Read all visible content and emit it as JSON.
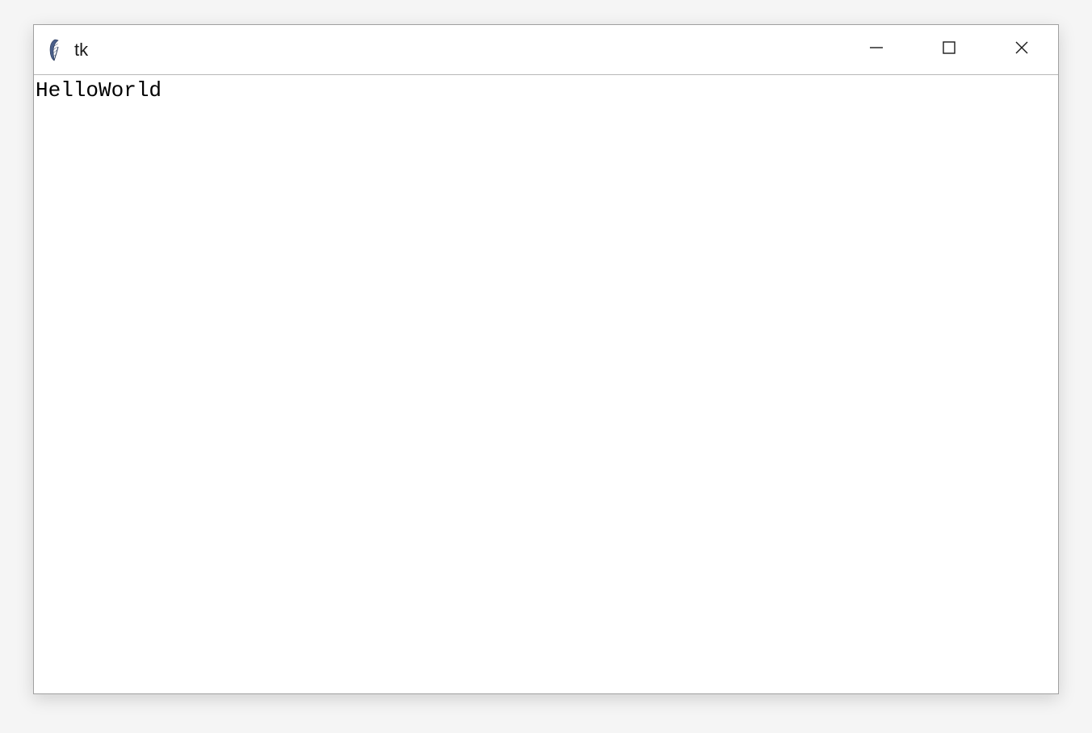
{
  "window": {
    "title": "tk",
    "icon_name": "feather-icon"
  },
  "content": {
    "label": "HelloWorld"
  },
  "controls": {
    "minimize": "minimize",
    "maximize": "maximize",
    "close": "close"
  }
}
